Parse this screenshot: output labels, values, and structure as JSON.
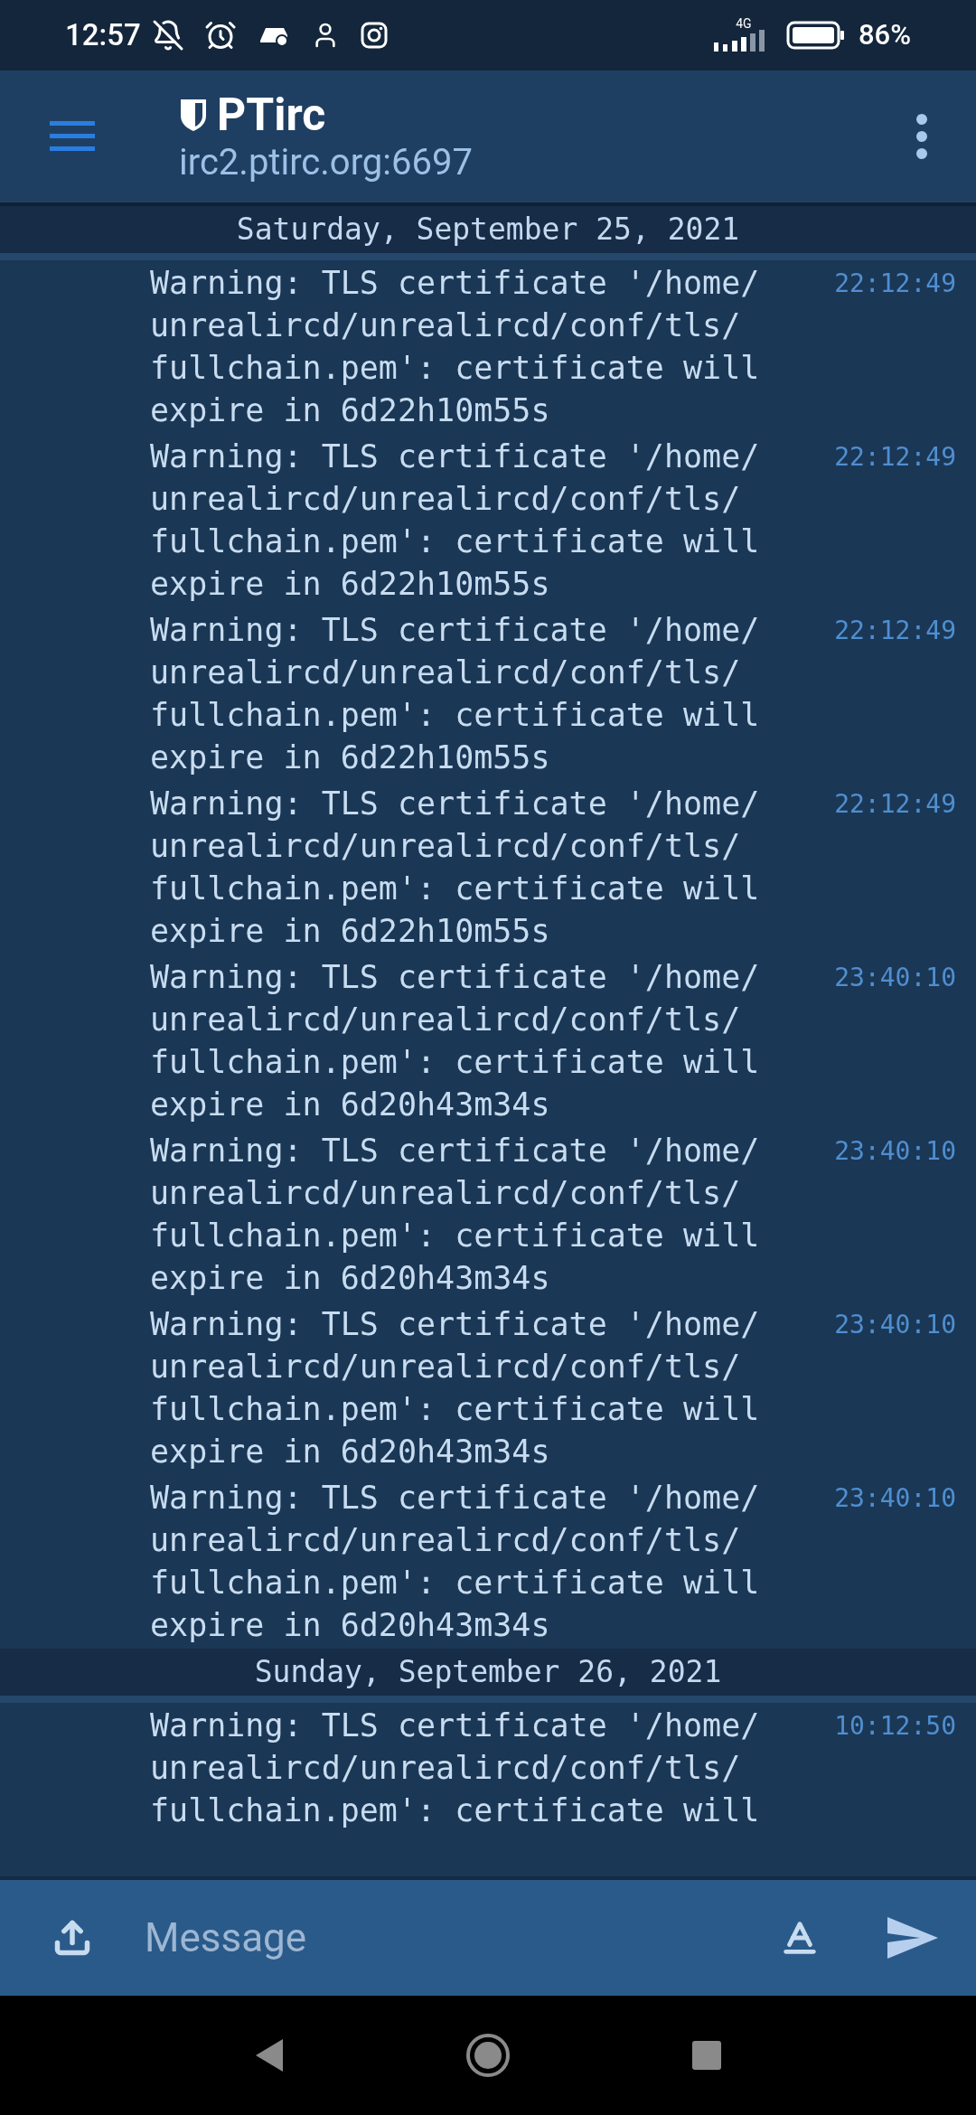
{
  "status_bar": {
    "time": "12:57",
    "network": "4G",
    "battery": "86%"
  },
  "header": {
    "title": "PTirc",
    "subtitle": "irc2.ptirc.org:6697"
  },
  "log": [
    {
      "kind": "date",
      "text": "Saturday, September 25, 2021"
    },
    {
      "kind": "message",
      "text": "Warning: TLS certificate '/home/\nunrealircd/unrealircd/conf/tls/\nfullchain.pem': certificate will\nexpire in 6d22h10m55s",
      "time": "22:12:49"
    },
    {
      "kind": "message",
      "text": "Warning: TLS certificate '/home/\nunrealircd/unrealircd/conf/tls/\nfullchain.pem': certificate will\nexpire in 6d22h10m55s",
      "time": "22:12:49"
    },
    {
      "kind": "message",
      "text": "Warning: TLS certificate '/home/\nunrealircd/unrealircd/conf/tls/\nfullchain.pem': certificate will\nexpire in 6d22h10m55s",
      "time": "22:12:49"
    },
    {
      "kind": "message",
      "text": "Warning: TLS certificate '/home/\nunrealircd/unrealircd/conf/tls/\nfullchain.pem': certificate will\nexpire in 6d22h10m55s",
      "time": "22:12:49"
    },
    {
      "kind": "message",
      "text": "Warning: TLS certificate '/home/\nunrealircd/unrealircd/conf/tls/\nfullchain.pem': certificate will\nexpire in 6d20h43m34s",
      "time": "23:40:10"
    },
    {
      "kind": "message",
      "text": "Warning: TLS certificate '/home/\nunrealircd/unrealircd/conf/tls/\nfullchain.pem': certificate will\nexpire in 6d20h43m34s",
      "time": "23:40:10"
    },
    {
      "kind": "message",
      "text": "Warning: TLS certificate '/home/\nunrealircd/unrealircd/conf/tls/\nfullchain.pem': certificate will\nexpire in 6d20h43m34s",
      "time": "23:40:10"
    },
    {
      "kind": "message",
      "text": "Warning: TLS certificate '/home/\nunrealircd/unrealircd/conf/tls/\nfullchain.pem': certificate will\nexpire in 6d20h43m34s",
      "time": "23:40:10"
    },
    {
      "kind": "date",
      "text": "Sunday, September 26, 2021"
    },
    {
      "kind": "message",
      "text": "Warning: TLS certificate '/home/\nunrealircd/unrealircd/conf/tls/\nfullchain.pem': certificate will",
      "time": "10:12:50"
    }
  ],
  "composer": {
    "placeholder": "Message"
  }
}
